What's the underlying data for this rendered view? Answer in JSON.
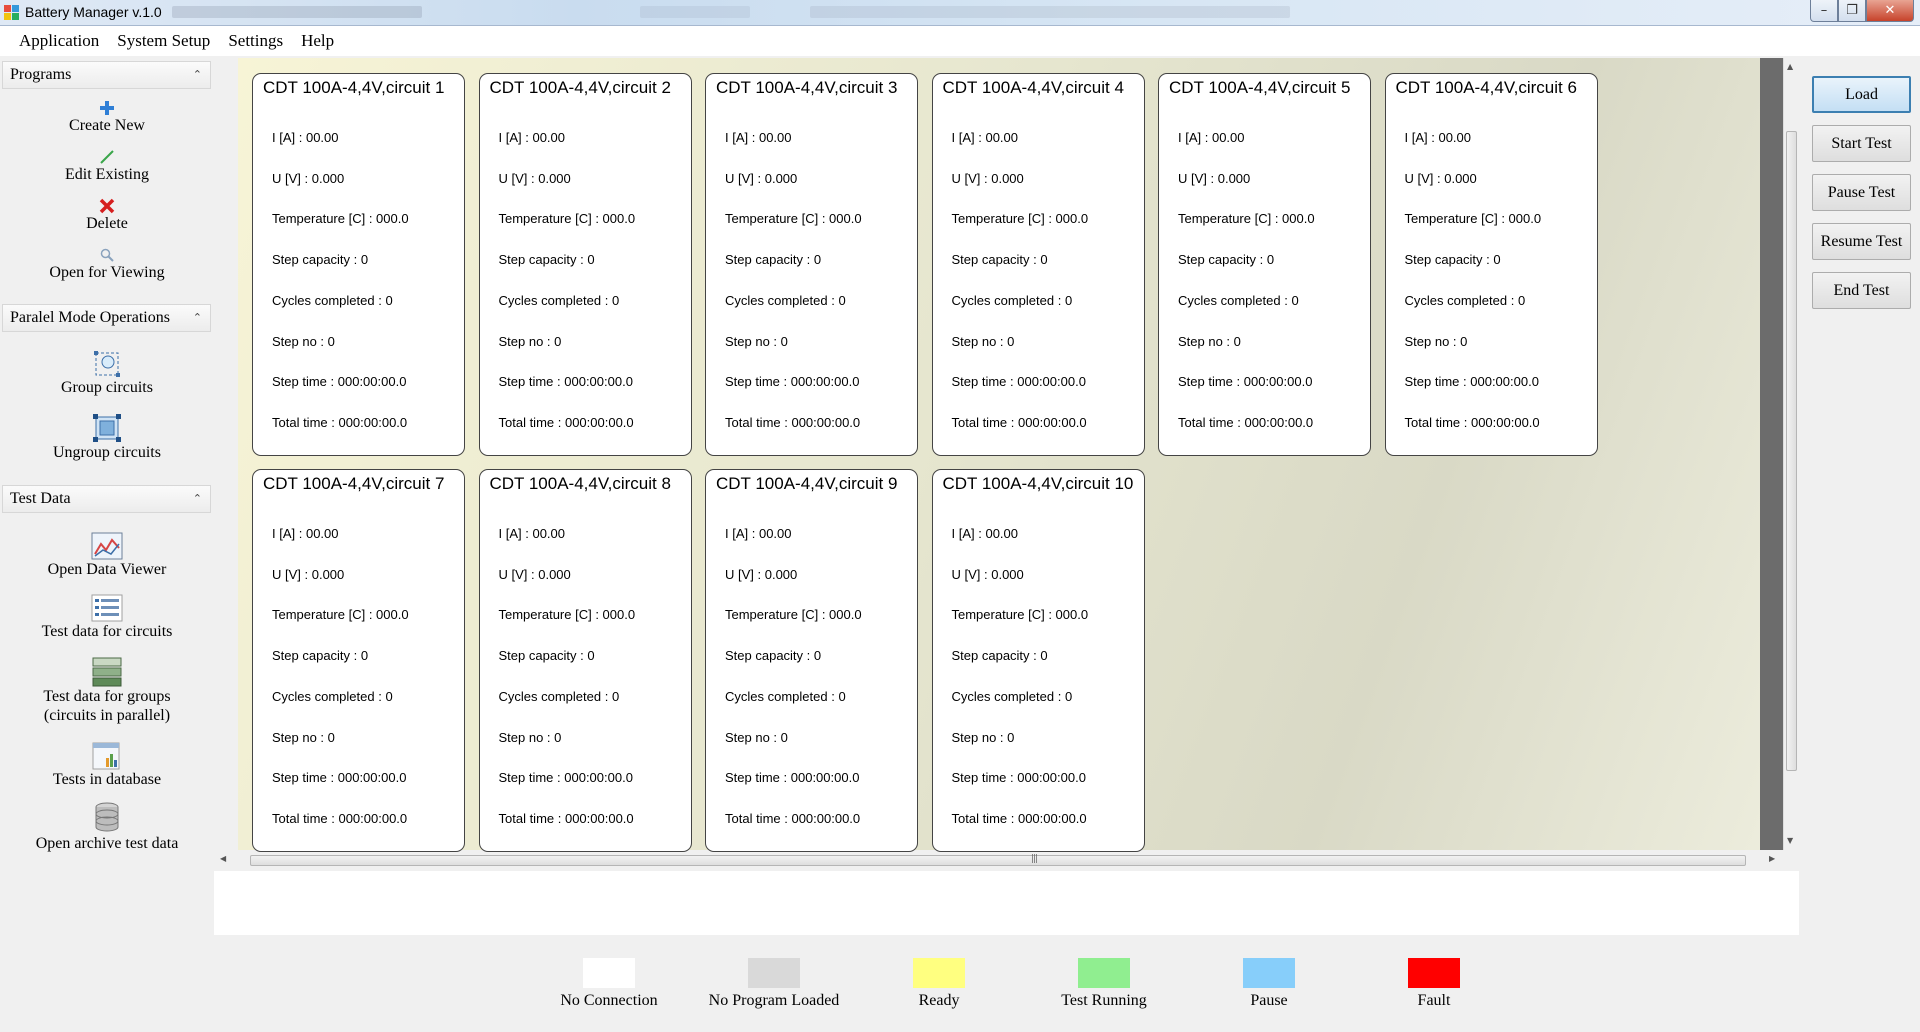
{
  "window": {
    "title": "Battery Manager v.1.0",
    "icon": "app-icon",
    "controls": [
      "minimize-icon",
      "restore-icon",
      "close-icon"
    ]
  },
  "menu": [
    {
      "label": "Application"
    },
    {
      "label": "System Setup"
    },
    {
      "label": "Settings"
    },
    {
      "label": "Help"
    }
  ],
  "sidebar": {
    "sections": [
      {
        "title": "Programs",
        "items": [
          {
            "label": "Create New",
            "icon": "plus-icon"
          },
          {
            "label": "Edit Existing",
            "icon": "pencil-icon"
          },
          {
            "label": "Delete",
            "icon": "delete-x-icon"
          },
          {
            "label": "Open for Viewing",
            "icon": "magnifier-icon"
          }
        ]
      },
      {
        "title": "Paralel Mode Operations",
        "items": [
          {
            "label": "Group circuits",
            "icon": "group-circuits-icon"
          },
          {
            "label": "Ungroup circuits",
            "icon": "ungroup-circuits-icon"
          }
        ]
      },
      {
        "title": "Test Data",
        "items": [
          {
            "label": "Open Data Viewer",
            "icon": "chart-icon"
          },
          {
            "label": "Test data for circuits",
            "icon": "list-icon"
          },
          {
            "label": "Test data for groups\n(circuits in parallel)",
            "icon": "grouped-list-icon"
          },
          {
            "label": "Tests in database",
            "icon": "database-report-icon"
          },
          {
            "label": "Open archive test data",
            "icon": "archive-database-icon"
          }
        ]
      }
    ]
  },
  "field_labels": {
    "current": "I [A] : ",
    "voltage": "U [V] : ",
    "temperature": "Temperature [C] : ",
    "step_capacity": "Step capacity : ",
    "cycles": "Cycles completed : ",
    "step_no": "Step no : ",
    "step_time": "Step time : ",
    "total_time": "Total time : "
  },
  "circuits": [
    {
      "title": "CDT 100A-4,4V,circuit 1",
      "current": "00.00",
      "voltage": "0.000",
      "temperature": "000.0",
      "step_capacity": "0",
      "cycles": "0",
      "step_no": "0",
      "step_time": "000:00:00.0",
      "total_time": "000:00:00.0"
    },
    {
      "title": "CDT 100A-4,4V,circuit 2",
      "current": "00.00",
      "voltage": "0.000",
      "temperature": "000.0",
      "step_capacity": "0",
      "cycles": "0",
      "step_no": "0",
      "step_time": "000:00:00.0",
      "total_time": "000:00:00.0"
    },
    {
      "title": "CDT 100A-4,4V,circuit 3",
      "current": "00.00",
      "voltage": "0.000",
      "temperature": "000.0",
      "step_capacity": "0",
      "cycles": "0",
      "step_no": "0",
      "step_time": "000:00:00.0",
      "total_time": "000:00:00.0"
    },
    {
      "title": "CDT 100A-4,4V,circuit 4",
      "current": "00.00",
      "voltage": "0.000",
      "temperature": "000.0",
      "step_capacity": "0",
      "cycles": "0",
      "step_no": "0",
      "step_time": "000:00:00.0",
      "total_time": "000:00:00.0"
    },
    {
      "title": "CDT 100A-4,4V,circuit 5",
      "current": "00.00",
      "voltage": "0.000",
      "temperature": "000.0",
      "step_capacity": "0",
      "cycles": "0",
      "step_no": "0",
      "step_time": "000:00:00.0",
      "total_time": "000:00:00.0"
    },
    {
      "title": "CDT 100A-4,4V,circuit 6",
      "current": "00.00",
      "voltage": "0.000",
      "temperature": "000.0",
      "step_capacity": "0",
      "cycles": "0",
      "step_no": "0",
      "step_time": "000:00:00.0",
      "total_time": "000:00:00.0"
    },
    {
      "title": "CDT 100A-4,4V,circuit 7",
      "current": "00.00",
      "voltage": "0.000",
      "temperature": "000.0",
      "step_capacity": "0",
      "cycles": "0",
      "step_no": "0",
      "step_time": "000:00:00.0",
      "total_time": "000:00:00.0"
    },
    {
      "title": "CDT 100A-4,4V,circuit 8",
      "current": "00.00",
      "voltage": "0.000",
      "temperature": "000.0",
      "step_capacity": "0",
      "cycles": "0",
      "step_no": "0",
      "step_time": "000:00:00.0",
      "total_time": "000:00:00.0"
    },
    {
      "title": "CDT 100A-4,4V,circuit 9",
      "current": "00.00",
      "voltage": "0.000",
      "temperature": "000.0",
      "step_capacity": "0",
      "cycles": "0",
      "step_no": "0",
      "step_time": "000:00:00.0",
      "total_time": "000:00:00.0"
    },
    {
      "title": "CDT 100A-4,4V,circuit 10",
      "current": "00.00",
      "voltage": "0.000",
      "temperature": "000.0",
      "step_capacity": "0",
      "cycles": "0",
      "step_no": "0",
      "step_time": "000:00:00.0",
      "total_time": "000:00:00.0"
    }
  ],
  "actions": [
    {
      "label": "Load",
      "name": "load-button",
      "focused": true
    },
    {
      "label": "Start Test",
      "name": "start-test-button",
      "focused": false
    },
    {
      "label": "Pause Test",
      "name": "pause-test-button",
      "focused": false
    },
    {
      "label": "Resume Test",
      "name": "resume-test-button",
      "focused": false
    },
    {
      "label": "End Test",
      "name": "end-test-button",
      "focused": false
    }
  ],
  "legend": [
    {
      "label": "No Connection",
      "color": "#ffffff"
    },
    {
      "label": "No Program Loaded",
      "color": "#d9d9d9"
    },
    {
      "label": "Ready",
      "color": "#ffff80"
    },
    {
      "label": "Test Running",
      "color": "#90ee90"
    },
    {
      "label": "Pause",
      "color": "#87cefa"
    },
    {
      "label": "Fault",
      "color": "#ff0000"
    }
  ],
  "colors": {
    "card_border": "#444444",
    "panel_background": "#e6e6cf",
    "focused_button_border": "#3c7fb1"
  }
}
